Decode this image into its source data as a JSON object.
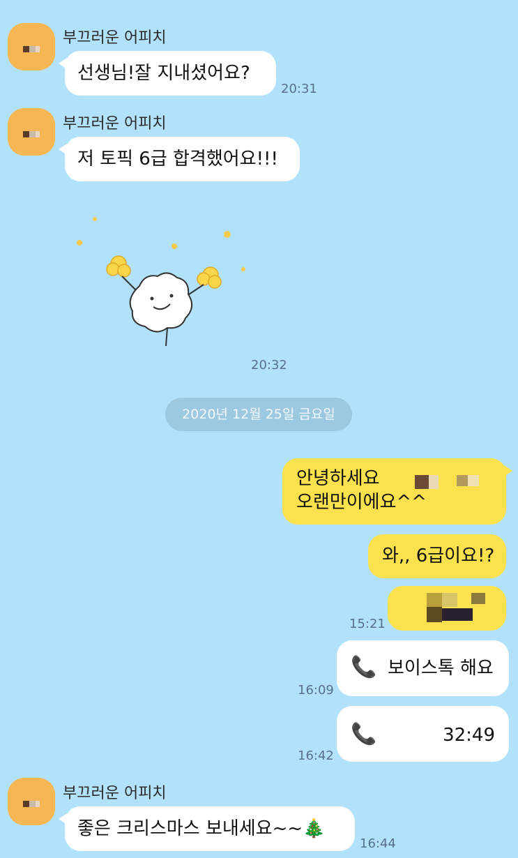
{
  "messages": {
    "m1": {
      "sender": "부끄러운 어피치",
      "text": "선생님!잘 지내셨어요?",
      "time": "20:31"
    },
    "m2": {
      "sender": "부끄러운 어피치",
      "text": "저 토픽 6급 합격했어요!!!",
      "time": ""
    },
    "sticker": {
      "time": "20:32"
    },
    "date_divider": "2020년 12월 25일 금요일",
    "m3": {
      "line1": "안녕하세요",
      "line2": "오랜만이에요^^"
    },
    "m4": {
      "text": "와,, 6급이요!?"
    },
    "m5": {
      "time": "15:21"
    },
    "m6": {
      "text": "보이스톡 해요",
      "time": "16:09"
    },
    "m7": {
      "text": "32:49",
      "time": "16:42"
    },
    "m8": {
      "sender": "부끄러운 어피치",
      "text": "좋은 크리스마스 보내세요~~🎄",
      "time": "16:44"
    }
  },
  "colors": {
    "background": "#b2e1fb",
    "outgoing": "#fbe14d",
    "incoming": "#ffffff",
    "avatar": "#f6b654"
  },
  "icons": {
    "call": "phone-icon",
    "sticker": "cotton-character-sticker"
  }
}
